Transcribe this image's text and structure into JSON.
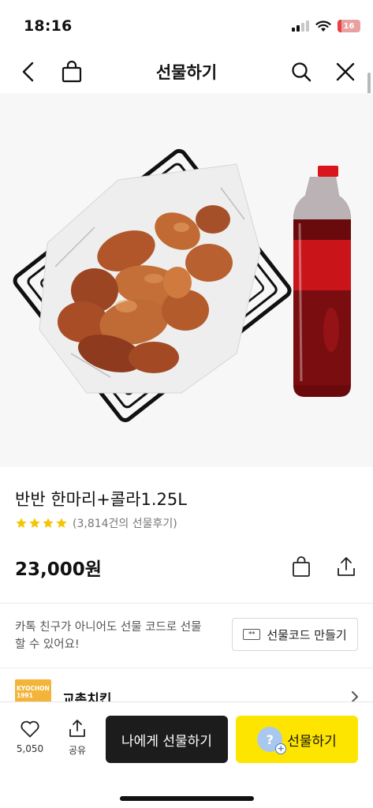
{
  "status_bar": {
    "time": "18:16",
    "battery": "16",
    "battery_level": 0.16
  },
  "nav": {
    "title": "선물하기"
  },
  "product": {
    "name": "반반 한마리+콜라1.25L",
    "rating_stars": 4,
    "review_text": "(3,814건의 선물후기)",
    "price": "23,000원"
  },
  "gift_code": {
    "description": "카톡 친구가 아니어도 선물 코드로 선물 할 수 있어요!",
    "button_label": "선물코드 만들기"
  },
  "brand": {
    "logo_text": "KYOCHON 1991",
    "name": "교촌치킨"
  },
  "bottom": {
    "like_count": "5,050",
    "share_label": "공유",
    "gift_me_label": "나에게 선물하기",
    "gift_label": "선물하기"
  },
  "colors": {
    "kakao_yellow": "#fee500",
    "dark_button": "#1c1c1c",
    "star": "#f6c400",
    "cola_red": "#c9141a"
  },
  "icons": [
    "back-icon",
    "shopping-bag-icon",
    "search-icon",
    "close-icon",
    "star-icon",
    "cart-icon",
    "share-icon",
    "code-icon",
    "chevron-right-icon",
    "heart-icon",
    "avatar-plus-icon"
  ]
}
